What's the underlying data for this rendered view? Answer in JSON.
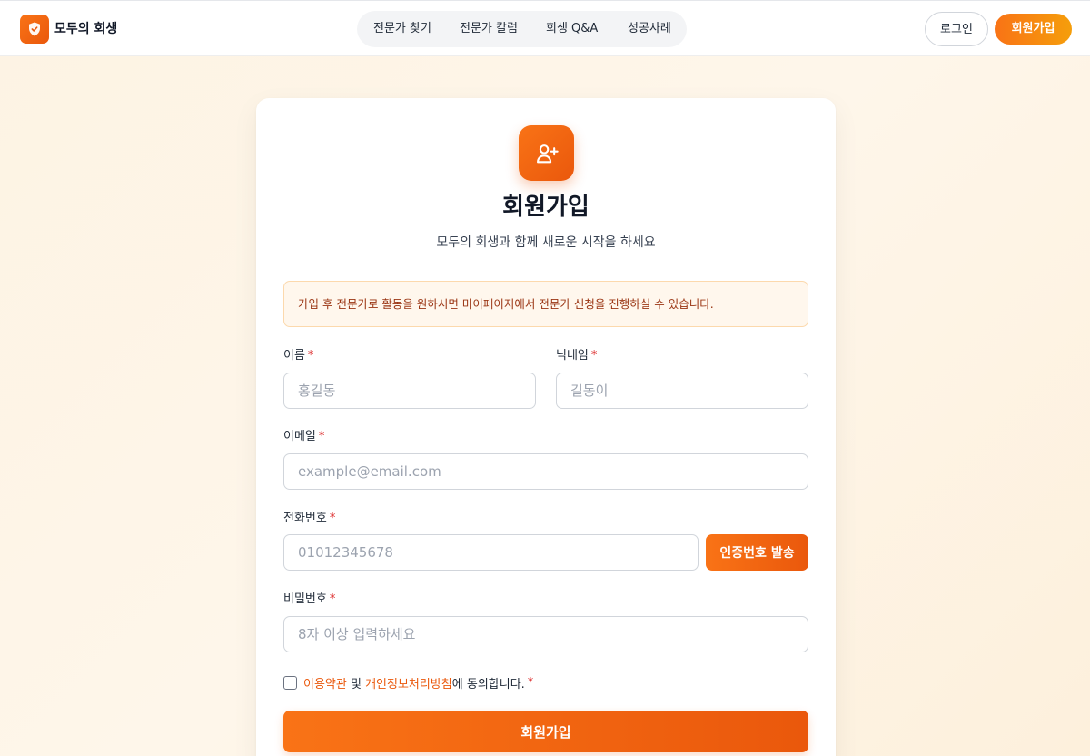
{
  "header": {
    "brand": "모두의 회생",
    "nav": [
      {
        "label": "전문가 찾기"
      },
      {
        "label": "전문가 칼럼"
      },
      {
        "label": "회생 Q&A"
      },
      {
        "label": "성공사례"
      }
    ],
    "login_label": "로그인",
    "signup_label": "회원가입"
  },
  "form": {
    "title": "회원가입",
    "subtitle": "모두의 회생과 함께 새로운 시작을 하세요",
    "notice": "가입 후 전문가로 활동을 원하시면 마이페이지에서 전문가 신청을 진행하실 수 있습니다.",
    "required_mark": "*",
    "fields": {
      "name": {
        "label": "이름",
        "placeholder": "홍길동"
      },
      "nickname": {
        "label": "닉네임",
        "placeholder": "길동이"
      },
      "email": {
        "label": "이메일",
        "placeholder": "example@email.com"
      },
      "phone": {
        "label": "전화번호",
        "placeholder": "01012345678"
      },
      "password": {
        "label": "비밀번호",
        "placeholder": "8자 이상 입력하세요"
      }
    },
    "verify_button": "인증번호 발송",
    "agree": {
      "terms_link": "이용약관",
      "and_text": " 및 ",
      "privacy_link": "개인정보처리방침",
      "suffix": "에 동의합니다.",
      "checked": false
    },
    "submit_label": "회원가입"
  },
  "colors": {
    "accent": "#f97316",
    "accent_dark": "#ea580c",
    "required": "#dc2626",
    "notice_bg": "#fff7ed",
    "notice_text": "#9a3412"
  },
  "icons": {
    "brand": "shield-check-icon",
    "form": "user-plus-icon"
  }
}
